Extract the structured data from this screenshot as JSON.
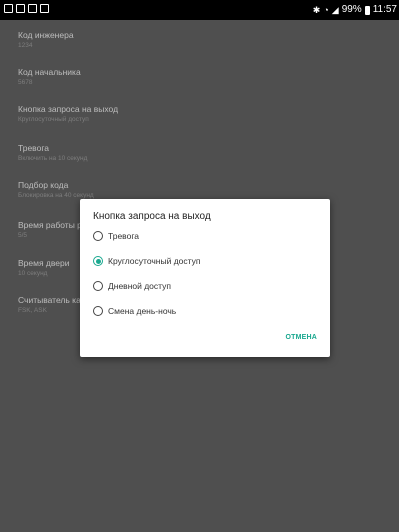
{
  "status_bar": {
    "left_icons": [
      "gallery-icon",
      "message-icon",
      "email-icon",
      "shop-icon"
    ],
    "right_text": "99%",
    "time": "11:57",
    "right_icons": [
      "bluetooth-icon",
      "wifi-icon",
      "signal-icon",
      "battery-icon"
    ]
  },
  "settings": [
    {
      "title": "Код инженера",
      "subtitle": "1234"
    },
    {
      "title": "Код начальника",
      "subtitle": "5678"
    },
    {
      "title": "Кнопка запроса на выход",
      "subtitle": "Круглосуточный доступ"
    },
    {
      "title": "Тревога",
      "subtitle": "Включить на 10 секунд"
    },
    {
      "title": "Подбор кода",
      "subtitle": "Блокировка на 40 секунд"
    },
    {
      "title": "Время работы р",
      "subtitle": "5/5"
    },
    {
      "title": "Время двери",
      "subtitle": "10 секунд"
    },
    {
      "title": "Считыватель ка",
      "subtitle": "FSK, ASK"
    }
  ],
  "dialog": {
    "title": "Кнопка запроса на выход",
    "options": [
      {
        "label": "Тревога",
        "selected": false
      },
      {
        "label": "Круглосуточный доступ",
        "selected": true
      },
      {
        "label": "Дневной доступ",
        "selected": false
      },
      {
        "label": "Смена день-ночь",
        "selected": false
      }
    ],
    "cancel_label": "ОТМЕНА",
    "accent_color": "#19a88f"
  }
}
